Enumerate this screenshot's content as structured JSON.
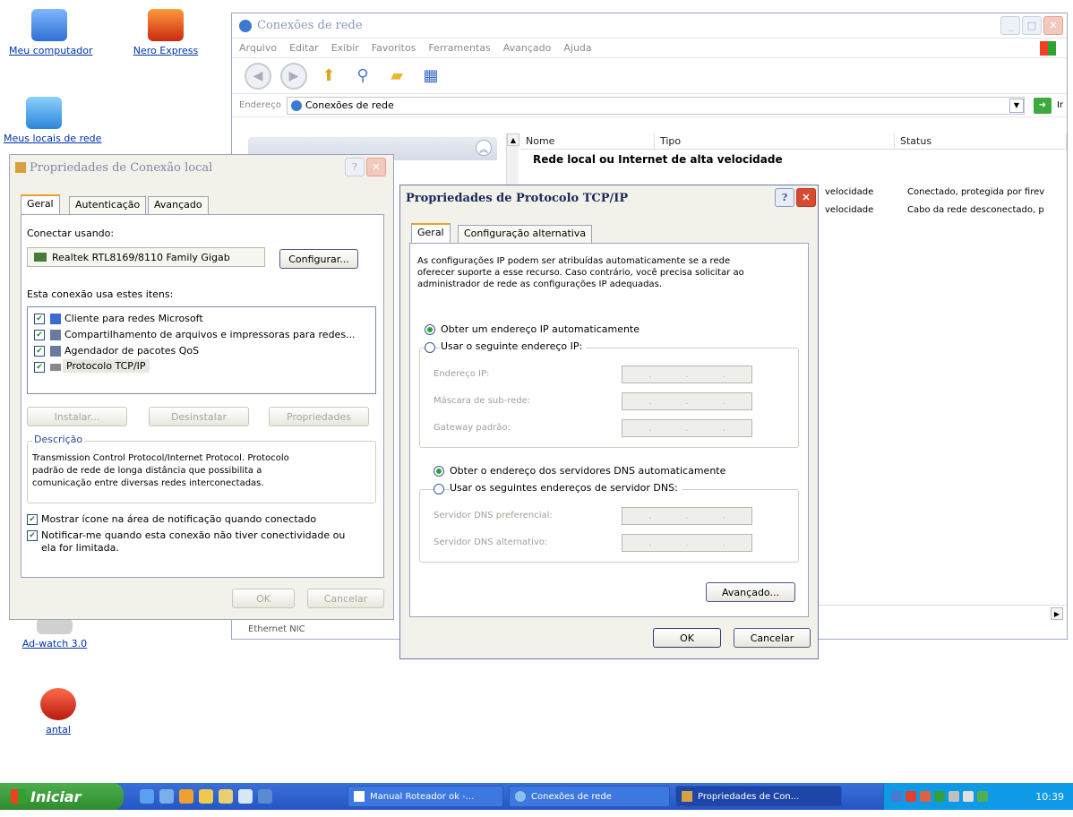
{
  "desktop": {
    "icons": [
      {
        "label": "Meu computador"
      },
      {
        "label": "Nero Express"
      },
      {
        "label": "Meus locais de rede"
      },
      {
        "label": "Ad-watch 3.0"
      },
      {
        "label": "antal"
      }
    ]
  },
  "explorer": {
    "title": "Conexões de rede",
    "menu": [
      "Arquivo",
      "Editar",
      "Exibir",
      "Favoritos",
      "Ferramentas",
      "Avançado",
      "Ajuda"
    ],
    "address_label": "Endereço",
    "address_value": "Conexões de rede",
    "go_label": "Ir",
    "columns": {
      "name": "Nome",
      "type": "Tipo",
      "status": "Status"
    },
    "group_title": "Rede local ou Internet de alta velocidade",
    "rows": [
      {
        "type": "velocidade",
        "status": "Conectado, protegida por firev"
      },
      {
        "type": "velocidade",
        "status": "Cabo da rede desconectado, p"
      }
    ],
    "left_fragment": "Ethernet NIC"
  },
  "lan_dialog": {
    "title": "Propriedades de Conexão local",
    "tabs": [
      "Geral",
      "Autenticação",
      "Avançado"
    ],
    "connect_using_label": "Conectar usando:",
    "adapter": "Realtek RTL8169/8110 Family Gigab",
    "configure_label": "Configurar...",
    "items_label": "Esta conexão usa estes itens:",
    "items": [
      {
        "label": "Cliente para redes Microsoft"
      },
      {
        "label": "Compartilhamento de arquivos e impressoras para redes..."
      },
      {
        "label": "Agendador de pacotes QoS"
      },
      {
        "label": "Protocolo TCP/IP"
      }
    ],
    "install_label": "Instalar...",
    "uninstall_label": "Desinstalar",
    "properties_label": "Propriedades",
    "description_legend": "Descrição",
    "description_lines": [
      "Transmission Control Protocol/Internet Protocol. Protocolo",
      "padrão de rede de longa distância que possibilita a",
      "comunicação entre diversas redes interconectadas."
    ],
    "show_icon_label": "Mostrar ícone na área de notificação quando conectado",
    "notify_lines": [
      "Notificar-me quando esta conexão não tiver conectividade ou",
      "ela for limitada."
    ],
    "ok_label": "OK",
    "cancel_label": "Cancelar"
  },
  "tcp_dialog": {
    "title": "Propriedades de Protocolo TCP/IP",
    "tabs": [
      "Geral",
      "Configuração alternativa"
    ],
    "intro_lines": [
      "As configurações IP podem ser atribuídas automaticamente se a rede",
      "oferecer suporte a esse recurso. Caso contrário, você precisa solicitar ao",
      "administrador de rede as configurações IP adequadas."
    ],
    "auto_ip_label": "Obter um endereço IP automaticamente",
    "manual_ip_label": "Usar o seguinte endereço IP:",
    "ip_label": "Endereço IP:",
    "mask_label": "Máscara de sub-rede:",
    "gateway_label": "Gateway padrão:",
    "auto_dns_label": "Obter o endereço dos servidores DNS automaticamente",
    "manual_dns_label": "Usar os seguintes endereços de servidor DNS:",
    "pref_dns_label": "Servidor DNS preferencial:",
    "alt_dns_label": "Servidor DNS alternativo:",
    "advanced_label": "Avançado...",
    "ok_label": "OK",
    "cancel_label": "Cancelar"
  },
  "taskbar": {
    "start_label": "Iniciar",
    "tasks": [
      {
        "label": "Manual Roteador ok -..."
      },
      {
        "label": "Conexões de rede"
      },
      {
        "label": "Propriedades de Con..."
      }
    ],
    "clock": "10:39"
  },
  "colors": {
    "taskbar": "#2456c4",
    "start": "#2f8c2f",
    "dialog_bg": "#f2f1ea",
    "link": "#0033aa"
  }
}
